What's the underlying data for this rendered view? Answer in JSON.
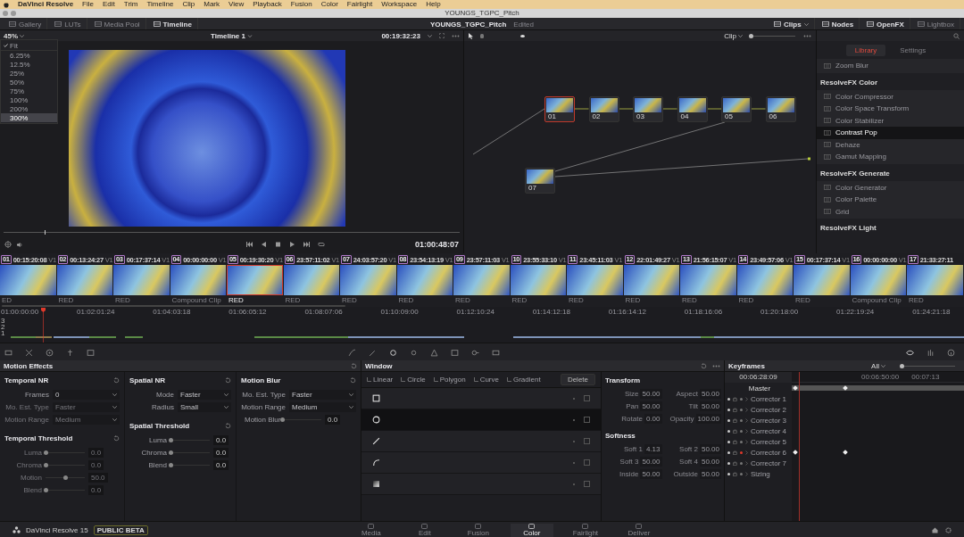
{
  "menu_bar": {
    "items": [
      "DaVinci Resolve",
      "File",
      "Edit",
      "Trim",
      "Timeline",
      "Clip",
      "Mark",
      "View",
      "Playback",
      "Fusion",
      "Color",
      "Fairlight",
      "Workspace",
      "Help"
    ]
  },
  "window": {
    "title": "YOUNGS_TGPC_Pitch"
  },
  "toolbar": {
    "left": [
      {
        "label": "Gallery",
        "selected": false
      },
      {
        "label": "LUTs",
        "selected": false
      },
      {
        "label": "Media Pool",
        "selected": false
      },
      {
        "label": "Timeline",
        "selected": true
      }
    ],
    "project": "YOUNGS_TGPC_Pitch",
    "status": "Edited",
    "right": [
      {
        "label": "Clips",
        "selected": true
      },
      {
        "label": "Nodes",
        "selected": true
      },
      {
        "label": "OpenFX",
        "selected": true
      },
      {
        "label": "Lightbox",
        "selected": false
      }
    ]
  },
  "viewer": {
    "zoom": "45%",
    "timeline": "Timeline 1",
    "timecode": "00:19:32:23",
    "playhead_timecode": "01:00:48:07",
    "zoom_menu": [
      {
        "label": "Fit",
        "checked": true,
        "selected": false
      },
      {
        "label": "6.25%",
        "checked": false,
        "selected": false
      },
      {
        "label": "12.5%",
        "checked": false,
        "selected": false
      },
      {
        "label": "25%",
        "checked": false,
        "selected": false
      },
      {
        "label": "50%",
        "checked": false,
        "selected": false
      },
      {
        "label": "75%",
        "checked": false,
        "selected": false
      },
      {
        "label": "100%",
        "checked": false,
        "selected": false
      },
      {
        "label": "200%",
        "checked": false,
        "selected": false
      },
      {
        "label": "300%",
        "checked": false,
        "selected": true
      }
    ]
  },
  "nodes": {
    "mode": "Clip",
    "zoom": {
      "level": 0
    },
    "items": [
      {
        "label": "01",
        "selected": true
      },
      {
        "label": "02",
        "selected": false
      },
      {
        "label": "03",
        "selected": false
      },
      {
        "label": "04",
        "selected": false
      },
      {
        "label": "05",
        "selected": false
      },
      {
        "label": "06",
        "selected": false
      },
      {
        "label": "07",
        "selected": false
      }
    ]
  },
  "openfx": {
    "tabs": [
      {
        "label": "Library",
        "selected": true
      },
      {
        "label": "Settings",
        "selected": false
      }
    ],
    "groups": [
      {
        "items": [
          {
            "label": "Zoom Blur",
            "selected": false
          }
        ]
      },
      {
        "title": "ResolveFX Color",
        "items": [
          {
            "label": "Color Compressor",
            "selected": false
          },
          {
            "label": "Color Space Transform",
            "selected": false
          },
          {
            "label": "Color Stabilizer",
            "selected": false
          },
          {
            "label": "Contrast Pop",
            "selected": true
          },
          {
            "label": "Dehaze",
            "selected": false
          },
          {
            "label": "Gamut Mapping",
            "selected": false
          }
        ]
      },
      {
        "title": "ResolveFX Generate",
        "items": [
          {
            "label": "Color Generator",
            "selected": false
          },
          {
            "label": "Color Palette",
            "selected": false
          },
          {
            "label": "Grid",
            "selected": false
          }
        ]
      },
      {
        "title": "ResolveFX Light"
      }
    ]
  },
  "clips": [
    {
      "number": "01",
      "timecode": "00:15:20:08",
      "track": "V1",
      "codec": "ED",
      "selected": false
    },
    {
      "number": "02",
      "timecode": "00:13:24:27",
      "track": "V1",
      "codec": "RED",
      "selected": false
    },
    {
      "number": "03",
      "timecode": "00:17:37:14",
      "track": "V1",
      "codec": "RED",
      "selected": false
    },
    {
      "number": "04",
      "timecode": "00:00:00:00",
      "track": "V1",
      "codec": "Compound Clip",
      "selected": false
    },
    {
      "number": "05",
      "timecode": "00:19:30:20",
      "track": "V1",
      "codec": "RED",
      "selected": true
    },
    {
      "number": "06",
      "timecode": "23:57:11:02",
      "track": "V1",
      "codec": "RED",
      "selected": false
    },
    {
      "number": "07",
      "timecode": "24:03:57:20",
      "track": "V1",
      "codec": "RED",
      "selected": false
    },
    {
      "number": "08",
      "timecode": "23:54:13:19",
      "track": "V1",
      "codec": "RED",
      "selected": false
    },
    {
      "number": "09",
      "timecode": "23:57:11:03",
      "track": "V1",
      "codec": "RED",
      "selected": false
    },
    {
      "number": "10",
      "timecode": "23:55:33:10",
      "track": "V1",
      "codec": "RED",
      "selected": false
    },
    {
      "number": "11",
      "timecode": "23:45:11:03",
      "track": "V1",
      "codec": "RED",
      "selected": false
    },
    {
      "number": "12",
      "timecode": "22:01:49:27",
      "track": "V1",
      "codec": "RED",
      "selected": false
    },
    {
      "number": "13",
      "timecode": "21:56:15:07",
      "track": "V1",
      "codec": "RED",
      "selected": false
    },
    {
      "number": "14",
      "timecode": "23:49:57:06",
      "track": "V1",
      "codec": "RED",
      "selected": false
    },
    {
      "number": "15",
      "timecode": "00:17:37:14",
      "track": "V1",
      "codec": "RED",
      "selected": false
    },
    {
      "number": "16",
      "timecode": "00:00:00:00",
      "track": "V1",
      "codec": "Compound Clip",
      "selected": false
    },
    {
      "number": "17",
      "timecode": "21:33:27:11",
      "codec": "RED",
      "selected": false
    }
  ],
  "timeline": {
    "ruler": [
      "01:00:00:00",
      "01:02:01:24",
      "01:04:03:18",
      "01:06:05:12",
      "01:08:07:06",
      "01:10:09:00",
      "01:12:10:24",
      "01:14:12:18",
      "01:16:14:12",
      "01:18:16:06",
      "01:20:18:00",
      "01:22:19:24",
      "01:24:21:18"
    ],
    "tracks": [
      "3",
      "2",
      "1"
    ]
  },
  "motion_effects": {
    "title": "Motion Effects",
    "columns": [
      {
        "sections": [
          {
            "title": "Temporal NR",
            "fields": [
              {
                "label": "Frames",
                "value": "0",
                "disabled": false
              },
              {
                "label": "Mo. Est. Type",
                "value": "Faster",
                "disabled": true
              },
              {
                "label": "Motion Range",
                "value": "Medium",
                "disabled": true
              }
            ]
          },
          {
            "title": "Temporal Threshold",
            "sliders": [
              {
                "label": "Luma",
                "value": "0.0",
                "level": 0,
                "disabled": true
              },
              {
                "label": "Chroma",
                "value": "0.0",
                "level": 0,
                "disabled": true
              },
              {
                "label": "Motion",
                "value": "50.0",
                "level": 0.5,
                "disabled": true
              },
              {
                "label": "Blend",
                "value": "0.0",
                "level": 0,
                "disabled": true
              }
            ]
          }
        ]
      },
      {
        "sections": [
          {
            "title": "Spatial NR",
            "fields": [
              {
                "label": "Mode",
                "value": "Faster",
                "disabled": false
              },
              {
                "label": "Radius",
                "value": "Small",
                "disabled": false
              }
            ]
          },
          {
            "title": "Spatial Threshold",
            "sliders": [
              {
                "label": "Luma",
                "value": "0.0",
                "level": 0,
                "disabled": false
              },
              {
                "label": "Chroma",
                "value": "0.0",
                "level": 0,
                "disabled": false
              },
              {
                "label": "Blend",
                "value": "0.0",
                "level": 0,
                "disabled": false
              }
            ]
          }
        ]
      },
      {
        "sections": [
          {
            "title": "Motion Blur",
            "fields": [
              {
                "label": "Mo. Est. Type",
                "value": "Faster",
                "disabled": false
              },
              {
                "label": "Motion Range",
                "value": "Medium",
                "disabled": false
              }
            ],
            "sliders": [
              {
                "label": "Motion Blur",
                "value": "0.0",
                "level": 0,
                "disabled": false
              }
            ]
          }
        ]
      }
    ]
  },
  "window_panel": {
    "title": "Window",
    "tools": [
      "Linear",
      "Circle",
      "Polygon",
      "Curve",
      "Gradient"
    ],
    "delete": "Delete",
    "shapes": [
      {
        "kind": "square",
        "selected": false
      },
      {
        "kind": "circle",
        "selected": true
      },
      {
        "kind": "line",
        "selected": false
      },
      {
        "kind": "curve",
        "selected": false
      },
      {
        "kind": "gradient",
        "selected": false
      }
    ],
    "transform": {
      "title": "Transform",
      "fields": [
        {
          "label": "Size",
          "value": "50.00"
        },
        {
          "label": "Aspect",
          "value": "50.00"
        },
        {
          "label": "Pan",
          "value": "50.00"
        },
        {
          "label": "Tilt",
          "value": "50.00"
        },
        {
          "label": "Rotate",
          "value": "0.00"
        },
        {
          "label": "Opacity",
          "value": "100.00"
        }
      ]
    },
    "softness": {
      "title": "Softness",
      "fields": [
        {
          "label": "Soft 1",
          "value": "4.13"
        },
        {
          "label": "Soft 2",
          "value": "50.00"
        },
        {
          "label": "Soft 3",
          "value": "50.00"
        },
        {
          "label": "Soft 4",
          "value": "50.00"
        },
        {
          "label": "Inside",
          "value": "50.00"
        },
        {
          "label": "Outside",
          "value": "50.00"
        }
      ]
    }
  },
  "keyframes": {
    "title": "Keyframes",
    "filter": "All",
    "zoom": {
      "level": 0
    },
    "timecode": "00:06:28:09",
    "ruler": [
      "00:06:50:00",
      "00:07:13"
    ],
    "tracks": [
      {
        "kind": "master",
        "label": "Master",
        "keyframed": true
      },
      {
        "kind": "track",
        "label": "Corrector 1",
        "keyframed": false
      },
      {
        "kind": "track",
        "label": "Corrector 2",
        "keyframed": false
      },
      {
        "kind": "track",
        "label": "Corrector 3",
        "keyframed": false
      },
      {
        "kind": "track",
        "label": "Corrector 4",
        "keyframed": false
      },
      {
        "kind": "track",
        "label": "Corrector 5",
        "keyframed": false
      },
      {
        "kind": "track",
        "label": "Corrector 6",
        "keyframed": true
      },
      {
        "kind": "track",
        "label": "Corrector 7",
        "keyframed": false
      },
      {
        "kind": "track",
        "label": "Sizing",
        "keyframed": false
      }
    ]
  },
  "footer": {
    "app": "DaVinci Resolve 15",
    "badge": "PUBLIC BETA",
    "pages": [
      {
        "label": "Media",
        "selected": false
      },
      {
        "label": "Edit",
        "selected": false
      },
      {
        "label": "Fusion",
        "selected": false
      },
      {
        "label": "Color",
        "selected": true
      },
      {
        "label": "Fairlight",
        "selected": false
      },
      {
        "label": "Deliver",
        "selected": false
      }
    ]
  }
}
